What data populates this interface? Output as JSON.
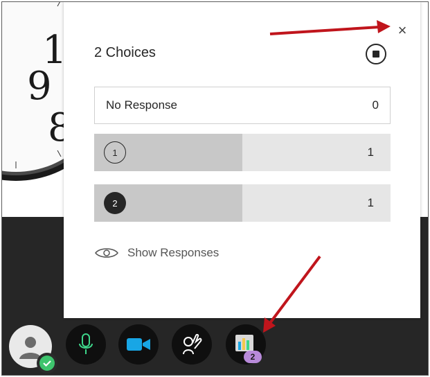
{
  "poll": {
    "title": "2 Choices",
    "close_glyph": "×",
    "no_response_label": "No Response",
    "no_response_count": "0",
    "choices": [
      {
        "number": "1",
        "count": "1",
        "fill_fraction": 0.5
      },
      {
        "number": "2",
        "count": "1",
        "fill_fraction": 0.5
      }
    ],
    "show_responses_label": "Show Responses"
  },
  "toolbar": {
    "poll_badge_count": "2",
    "icons": [
      "avatar-icon",
      "check-icon",
      "microphone-icon",
      "camera-icon",
      "raise-hand-icon",
      "poll-chart-icon"
    ]
  },
  "annotations": {
    "arrow_color": "#c0151c"
  },
  "colors": {
    "dark": "#262626",
    "mic_green": "#3ed68a",
    "camera_blue": "#18a6e5",
    "badge_purple": "#b88ad9",
    "check_green": "#3ec46d",
    "bar_fill": "#c8c8c8",
    "bar_track": "#e6e6e6"
  }
}
